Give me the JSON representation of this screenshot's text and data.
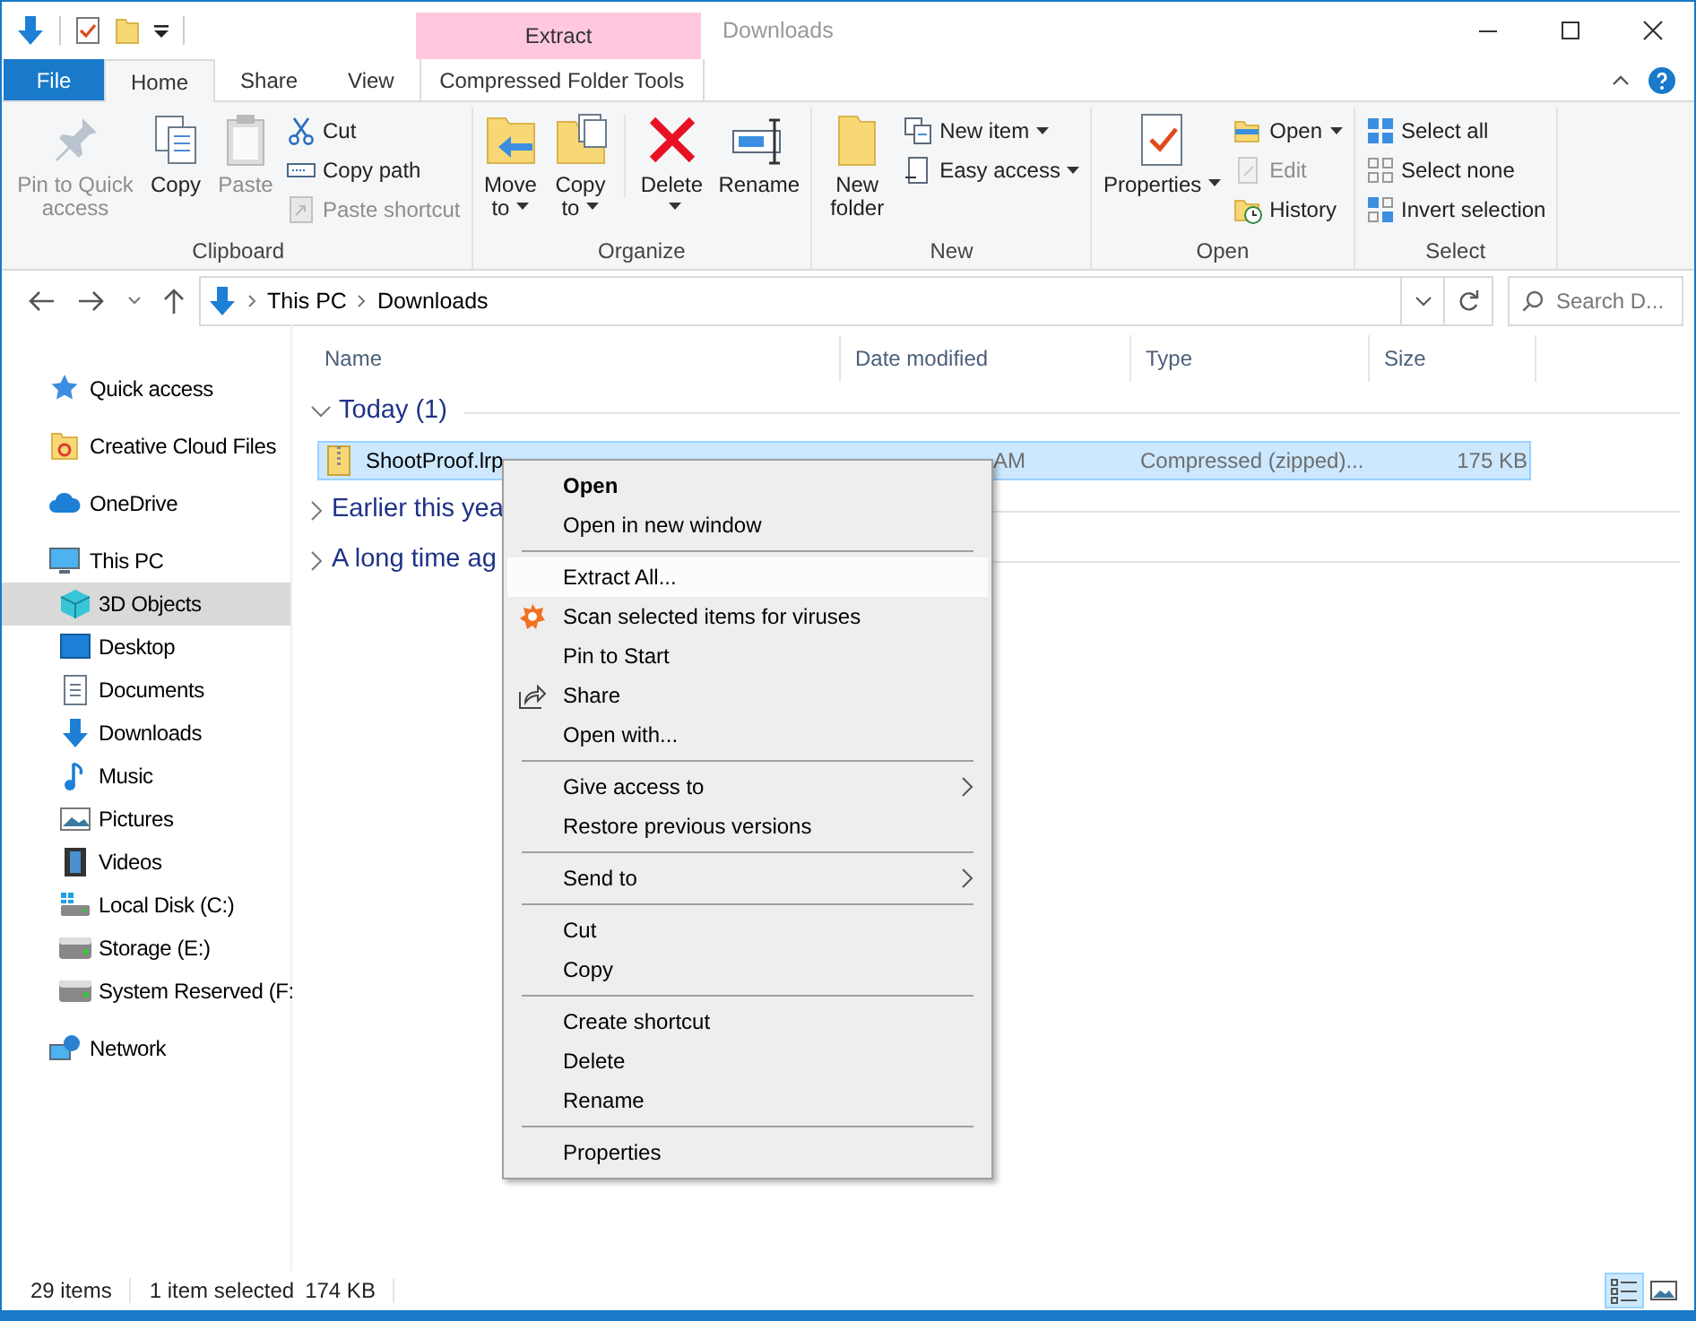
{
  "title_bar": {
    "context_tab": "Extract",
    "title": "Downloads"
  },
  "ribbon": {
    "tabs": [
      {
        "label": "File",
        "kind": "file",
        "selected": false
      },
      {
        "label": "Home",
        "kind": "normal",
        "selected": true
      },
      {
        "label": "Share",
        "kind": "normal",
        "selected": false
      },
      {
        "label": "View",
        "kind": "normal",
        "selected": false
      },
      {
        "label": "Compressed Folder Tools",
        "kind": "context",
        "selected": false
      }
    ],
    "groups": [
      {
        "label": "Clipboard",
        "commands": [
          {
            "label": "Pin to Quick access",
            "kind": "large",
            "dropdown": false,
            "disabled": true
          },
          {
            "label": "Copy",
            "kind": "large",
            "dropdown": false,
            "disabled": false
          },
          {
            "label": "Paste",
            "kind": "large",
            "dropdown": false,
            "disabled": true
          },
          {
            "label": "Cut",
            "kind": "small",
            "dropdown": false,
            "disabled": false
          },
          {
            "label": "Copy path",
            "kind": "small",
            "dropdown": false,
            "disabled": false
          },
          {
            "label": "Paste shortcut",
            "kind": "small",
            "dropdown": false,
            "disabled": true
          }
        ]
      },
      {
        "label": "Organize",
        "commands": [
          {
            "label": "Move to",
            "kind": "large",
            "dropdown": true,
            "disabled": false
          },
          {
            "label": "Copy to",
            "kind": "large",
            "dropdown": true,
            "disabled": false
          },
          {
            "label": "Delete",
            "kind": "large",
            "dropdown": true,
            "disabled": false
          },
          {
            "label": "Rename",
            "kind": "large",
            "dropdown": false,
            "disabled": false
          }
        ]
      },
      {
        "label": "New",
        "commands": [
          {
            "label": "New folder",
            "kind": "large",
            "dropdown": false,
            "disabled": false
          },
          {
            "label": "New item",
            "kind": "small",
            "dropdown": true,
            "disabled": false
          },
          {
            "label": "Easy access",
            "kind": "small",
            "dropdown": true,
            "disabled": false
          }
        ]
      },
      {
        "label": "Open",
        "commands": [
          {
            "label": "Properties",
            "kind": "large",
            "dropdown": true,
            "disabled": false
          },
          {
            "label": "Open",
            "kind": "small",
            "dropdown": true,
            "disabled": false
          },
          {
            "label": "Edit",
            "kind": "small",
            "dropdown": false,
            "disabled": true
          },
          {
            "label": "History",
            "kind": "small",
            "dropdown": false,
            "disabled": false
          }
        ]
      },
      {
        "label": "Select",
        "commands": [
          {
            "label": "Select all",
            "kind": "small",
            "dropdown": false,
            "disabled": false
          },
          {
            "label": "Select none",
            "kind": "small",
            "dropdown": false,
            "disabled": false
          },
          {
            "label": "Invert selection",
            "kind": "small",
            "dropdown": false,
            "disabled": false
          }
        ]
      }
    ]
  },
  "address_bar": {
    "breadcrumb": [
      "This PC",
      "Downloads"
    ],
    "search": {
      "placeholder": "Search D..."
    }
  },
  "navigation_pane": {
    "items": [
      {
        "label": "Quick access",
        "selected": false
      },
      {
        "label": "Creative Cloud Files",
        "selected": false
      },
      {
        "label": "OneDrive",
        "selected": false
      },
      {
        "label": "This PC",
        "selected": false,
        "children": [
          {
            "label": "3D Objects",
            "selected": true
          },
          {
            "label": "Desktop",
            "selected": false
          },
          {
            "label": "Documents",
            "selected": false
          },
          {
            "label": "Downloads",
            "selected": false
          },
          {
            "label": "Music",
            "selected": false
          },
          {
            "label": "Pictures",
            "selected": false
          },
          {
            "label": "Videos",
            "selected": false
          },
          {
            "label": "Local Disk (C:)",
            "selected": false
          },
          {
            "label": "Storage (E:)",
            "selected": false
          },
          {
            "label": "System Reserved (F:",
            "selected": false
          }
        ]
      },
      {
        "label": "Network",
        "selected": false
      }
    ]
  },
  "file_list": {
    "columns": [
      "Name",
      "Date modified",
      "Type",
      "Size"
    ],
    "groups": [
      {
        "label": "Today (1)",
        "expanded": true,
        "rows": [
          {
            "name": "ShootProof.lrp",
            "date_modified": "AM",
            "type": "Compressed (zipped)...",
            "size": "175 KB",
            "selected": true
          }
        ]
      },
      {
        "label": "Earlier this yea",
        "expanded": false
      },
      {
        "label": "A long time ag",
        "expanded": false
      }
    ]
  },
  "context_menu": {
    "items": [
      {
        "kind": "item",
        "label": "Open",
        "default": true,
        "selected": false,
        "submenu": false
      },
      {
        "kind": "item",
        "label": "Open in new window",
        "default": false,
        "selected": false,
        "submenu": false
      },
      {
        "kind": "separator"
      },
      {
        "kind": "item",
        "label": "Extract All...",
        "default": false,
        "selected": true,
        "submenu": false
      },
      {
        "kind": "item",
        "label": "Scan selected items for viruses",
        "default": false,
        "selected": false,
        "submenu": false
      },
      {
        "kind": "item",
        "label": "Pin to Start",
        "default": false,
        "selected": false,
        "submenu": false
      },
      {
        "kind": "item",
        "label": "Share",
        "default": false,
        "selected": false,
        "submenu": false
      },
      {
        "kind": "item",
        "label": "Open with...",
        "default": false,
        "selected": false,
        "submenu": false
      },
      {
        "kind": "separator"
      },
      {
        "kind": "item",
        "label": "Give access to",
        "default": false,
        "selected": false,
        "submenu": true
      },
      {
        "kind": "item",
        "label": "Restore previous versions",
        "default": false,
        "selected": false,
        "submenu": false
      },
      {
        "kind": "separator"
      },
      {
        "kind": "item",
        "label": "Send to",
        "default": false,
        "selected": false,
        "submenu": true
      },
      {
        "kind": "separator"
      },
      {
        "kind": "item",
        "label": "Cut",
        "default": false,
        "selected": false,
        "submenu": false
      },
      {
        "kind": "item",
        "label": "Copy",
        "default": false,
        "selected": false,
        "submenu": false
      },
      {
        "kind": "separator"
      },
      {
        "kind": "item",
        "label": "Create shortcut",
        "default": false,
        "selected": false,
        "submenu": false
      },
      {
        "kind": "item",
        "label": "Delete",
        "default": false,
        "selected": false,
        "submenu": false
      },
      {
        "kind": "item",
        "label": "Rename",
        "default": false,
        "selected": false,
        "submenu": false
      },
      {
        "kind": "separator"
      },
      {
        "kind": "item",
        "label": "Properties",
        "default": false,
        "selected": false,
        "submenu": false
      }
    ]
  },
  "status_bar": {
    "item_count": "29 items",
    "selection": "1 item selected",
    "selection_size": "174 KB",
    "view_buttons": [
      {
        "kind": "details",
        "selected": true
      },
      {
        "kind": "large-icons",
        "selected": false
      }
    ]
  }
}
